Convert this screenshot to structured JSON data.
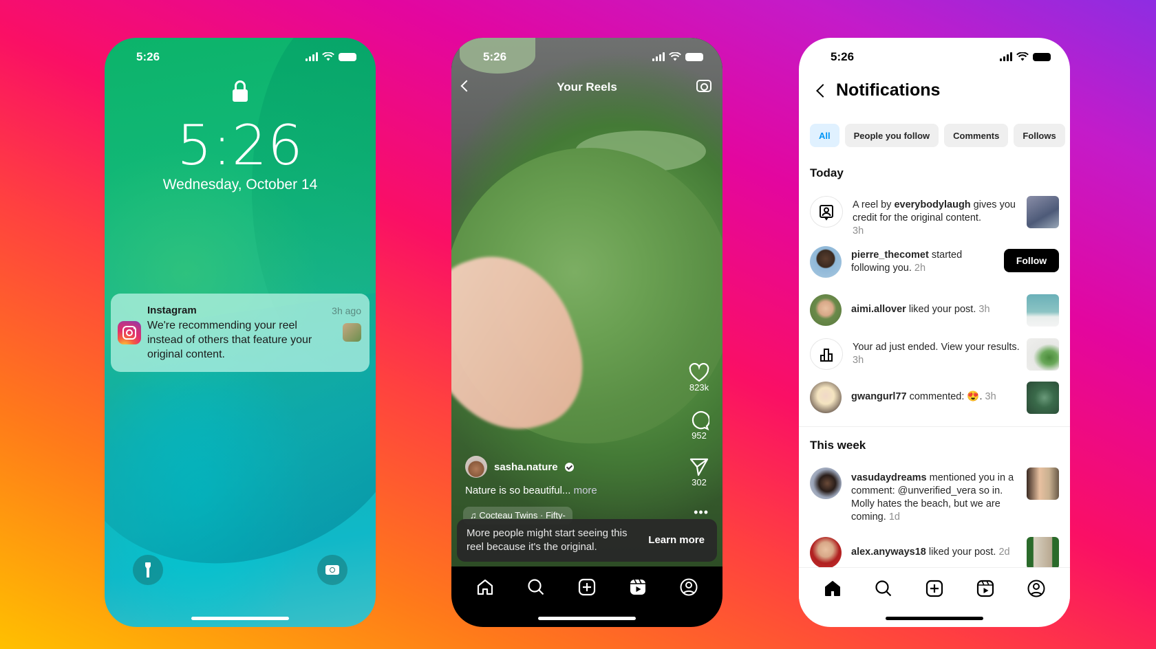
{
  "background": {
    "colors": [
      "#8e2de2",
      "#e3069f",
      "#fa0f65",
      "#ff7a1a",
      "#ffc000"
    ]
  },
  "lockscreen": {
    "status_time": "5:26",
    "clock": "5:26",
    "date": "Wednesday, October 14",
    "notification": {
      "app": "Instagram",
      "time_ago": "3h ago",
      "message": "We're recommending your reel instead of others that feature your original content."
    },
    "icons": [
      "lock-icon",
      "flashlight-icon",
      "camera-icon"
    ]
  },
  "reels": {
    "status_time": "5:26",
    "title": "Your Reels",
    "likes": "823k",
    "comments": "952",
    "shares": "302",
    "author": "sasha.nature",
    "caption": "Nature is so beautiful...",
    "caption_more": "more",
    "music": "Cocteau Twins · Fifty-",
    "toast_text": "More people might start seeing this reel because it's the original.",
    "toast_action": "Learn more",
    "nav": [
      "home",
      "search",
      "create",
      "reels",
      "profile"
    ]
  },
  "notifications": {
    "status_time": "5:26",
    "title": "Notifications",
    "filters": [
      {
        "label": "All",
        "active": true
      },
      {
        "label": "People you follow",
        "active": false
      },
      {
        "label": "Comments",
        "active": false
      },
      {
        "label": "Follows",
        "active": false
      }
    ],
    "sections": {
      "today": "Today",
      "this_week": "This week"
    },
    "items": [
      {
        "pre": "A reel by ",
        "user": "everybodylaugh",
        "text": " gives you credit for the original content.",
        "time": "3h"
      },
      {
        "pre": "",
        "user": "pierre_thecomet",
        "text": " started following you.",
        "time": "2h",
        "action": "Follow"
      },
      {
        "pre": "",
        "user": "aimi.allover",
        "text": " liked your post.",
        "time": "3h"
      },
      {
        "pre": "",
        "user": "",
        "text": "Your ad just ended. View your results.",
        "time": "3h"
      },
      {
        "pre": "",
        "user": "gwangurl77",
        "text": " commented: 😍.",
        "time": "3h"
      },
      {
        "pre": "",
        "user": "vasudaydreams",
        "text": " mentioned you in a comment: @unverified_vera so in. Molly hates the beach, but we are coming.",
        "time": "1d"
      },
      {
        "pre": "",
        "user": "alex.anyways18",
        "text": " liked your post.",
        "time": "2d"
      }
    ],
    "nav": [
      "home",
      "search",
      "create",
      "reels",
      "profile"
    ]
  }
}
